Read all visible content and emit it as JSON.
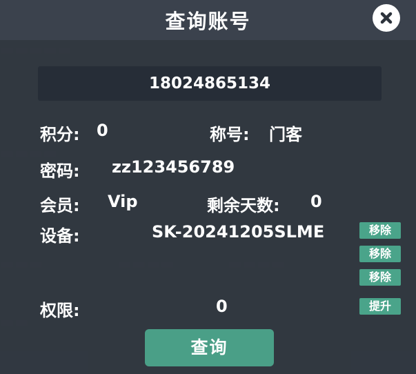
{
  "dialog": {
    "title": "查询账号",
    "close_icon": "close-icon"
  },
  "account": {
    "value": "18024865134"
  },
  "fields": {
    "points_label": "积分:",
    "points_value": "0",
    "title_label": "称号:",
    "title_value": "门客",
    "password_label": "密码:",
    "password_value": "zz123456789",
    "member_label": "会员:",
    "member_value": "Vip",
    "days_left_label": "剩余天数:",
    "days_left_value": "0",
    "device_label": "设备:",
    "device_value": "SK-20241205SLME",
    "permission_label": "权限:",
    "permission_value": "0"
  },
  "buttons": {
    "remove_1": "移除",
    "remove_2": "移除",
    "remove_3": "移除",
    "upgrade": "提升",
    "query": "查询"
  },
  "colors": {
    "accent": "#4aa48a",
    "panel": "#30373f",
    "input_bg": "#262d37",
    "text": "#ffffff"
  }
}
